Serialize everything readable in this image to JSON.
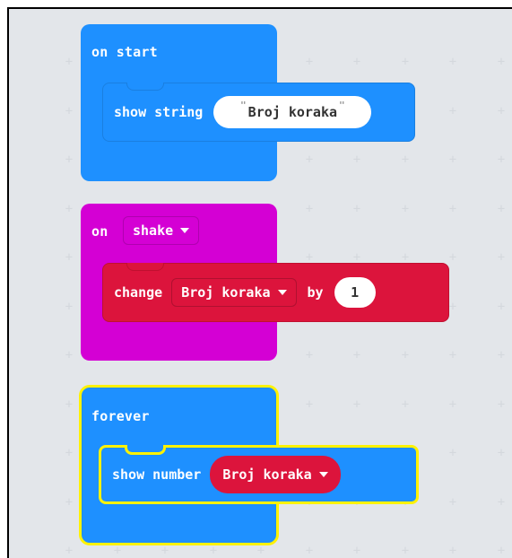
{
  "blocks": {
    "on_start": {
      "label": "on start",
      "statement": {
        "label": "show string",
        "value": "Broj koraka",
        "open_quote": "\"",
        "close_quote": "\""
      }
    },
    "on_shake": {
      "label": "on",
      "event": "shake",
      "statement": {
        "label": "change",
        "variable": "Broj koraka",
        "by_label": "by",
        "amount": "1"
      }
    },
    "forever": {
      "label": "forever",
      "statement": {
        "label": "show number",
        "variable": "Broj koraka"
      }
    }
  },
  "colors": {
    "basic_blue": "#1e90ff",
    "input_magenta": "#d400d4",
    "variable_red": "#dc143c",
    "selected_outline": "#fff200",
    "workspace_bg": "#f6f7f9"
  }
}
